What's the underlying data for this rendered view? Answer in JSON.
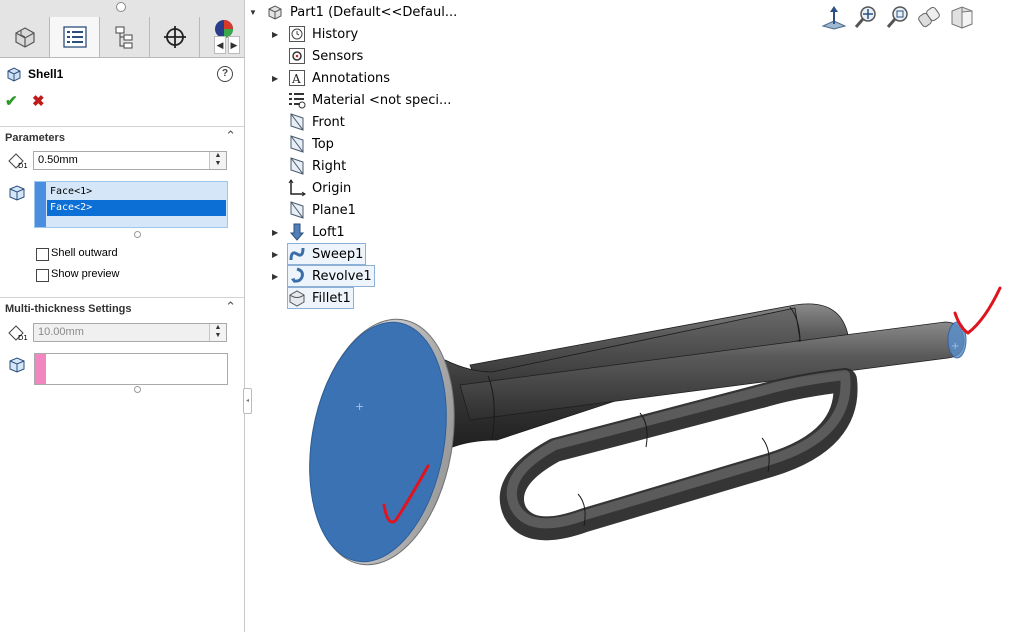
{
  "property_manager": {
    "tabs": [
      {
        "name": "feature-manager-tab",
        "icon": "part-cube-icon"
      },
      {
        "name": "property-manager-tab",
        "icon": "list-icon"
      },
      {
        "name": "configuration-manager-tab",
        "icon": "tree-icon"
      },
      {
        "name": "dimxpert-tab",
        "icon": "crosshair-icon"
      },
      {
        "name": "display-manager-tab",
        "icon": "appearance-sphere-icon"
      }
    ],
    "title": "Shell1",
    "parameters": {
      "header": "Parameters",
      "thickness_value": "0.50mm",
      "faces": [
        "Face<1>",
        "Face<2>"
      ],
      "shell_outward_label": "Shell outward",
      "show_preview_label": "Show preview"
    },
    "multi_thickness": {
      "header": "Multi-thickness Settings",
      "thickness_value": "10.00mm"
    }
  },
  "feature_tree": {
    "root_label": "Part1  (Default<<Defaul...",
    "items": [
      {
        "label": "History",
        "icon": "history-icon",
        "expandable": true
      },
      {
        "label": "Sensors",
        "icon": "sensors-icon",
        "expandable": false
      },
      {
        "label": "Annotations",
        "icon": "annotations-icon",
        "expandable": true
      },
      {
        "label": "Material <not speci...",
        "icon": "material-icon",
        "expandable": false
      },
      {
        "label": "Front",
        "icon": "plane-icon",
        "expandable": false
      },
      {
        "label": "Top",
        "icon": "plane-icon",
        "expandable": false
      },
      {
        "label": "Right",
        "icon": "plane-icon",
        "expandable": false
      },
      {
        "label": "Origin",
        "icon": "origin-icon",
        "expandable": false
      },
      {
        "label": "Plane1",
        "icon": "plane-icon",
        "expandable": false
      },
      {
        "label": "Loft1",
        "icon": "loft-icon",
        "expandable": true
      },
      {
        "label": "Sweep1",
        "icon": "sweep-icon",
        "expandable": true
      },
      {
        "label": "Revolve1",
        "icon": "revolve-icon",
        "expandable": true
      },
      {
        "label": "Fillet1",
        "icon": "fillet-icon",
        "expandable": false
      }
    ]
  },
  "view_toolbar": [
    "normal-to-icon",
    "zoom-to-fit-icon",
    "zoom-to-area-icon",
    "previous-view-icon",
    "section-view-icon"
  ],
  "colors": {
    "selected_face": "#3a72b4",
    "model_body": "#4a4a4a",
    "selection_blue": "#0b6fd6",
    "annotation_red": "#e0141e"
  }
}
